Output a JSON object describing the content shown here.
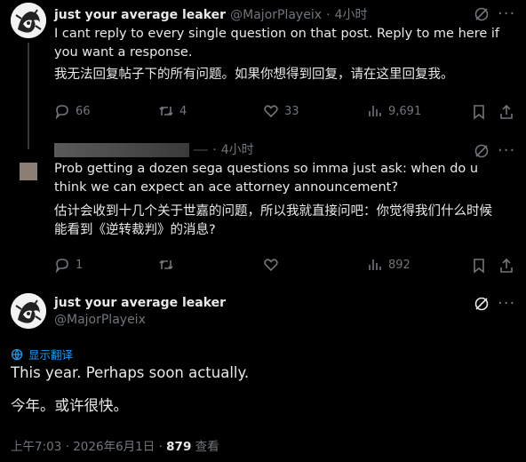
{
  "tweet1": {
    "display_name": "just your average leaker",
    "handle": "@MajorPlayeix",
    "sep": "·",
    "time": "4小时",
    "text_en": "I cant reply to every single question on that post. Reply to me here if you want a response.",
    "text_zh": "我无法回复帖子下的所有问题。如果你想得到回复，请在这里回复我。",
    "replies": "66",
    "retweets": "4",
    "likes": "33",
    "views": "9,691"
  },
  "tweet2": {
    "display_name": "",
    "handle": "",
    "sep": "·",
    "time": "4小时",
    "text_en": "Prob getting a dozen sega questions so imma just ask: when do u think we can expect an ace attorney announcement?",
    "text_zh": "估计会收到十几个关于世嘉的问题，所以我就直接问吧：你觉得我们什么时候能看到《逆转裁判》的消息?",
    "replies": "1",
    "retweets": "",
    "likes": "",
    "views": "892"
  },
  "main_tweet": {
    "display_name": "just your average leaker",
    "handle": "@MajorPlayeix",
    "translate_label": "显示翻译",
    "text_en": "This year. Perhaps soon actually.",
    "text_zh": "今年。或许很快。",
    "time": "上午7:03",
    "sep": "·",
    "date": "2026年6月1日",
    "sep2": "·",
    "views_count": "879",
    "views_label": "查看"
  },
  "icons": {
    "grok": "grok-icon",
    "more": "more-icon",
    "reply": "reply-icon",
    "retweet": "retweet-icon",
    "like": "heart-icon",
    "views": "views-icon",
    "bookmark": "bookmark-icon",
    "share": "share-icon",
    "globe": "globe-icon"
  },
  "colors": {
    "background": "#000000",
    "text": "#e7e9ea",
    "muted": "#71767b",
    "link": "#1d9bf0"
  }
}
